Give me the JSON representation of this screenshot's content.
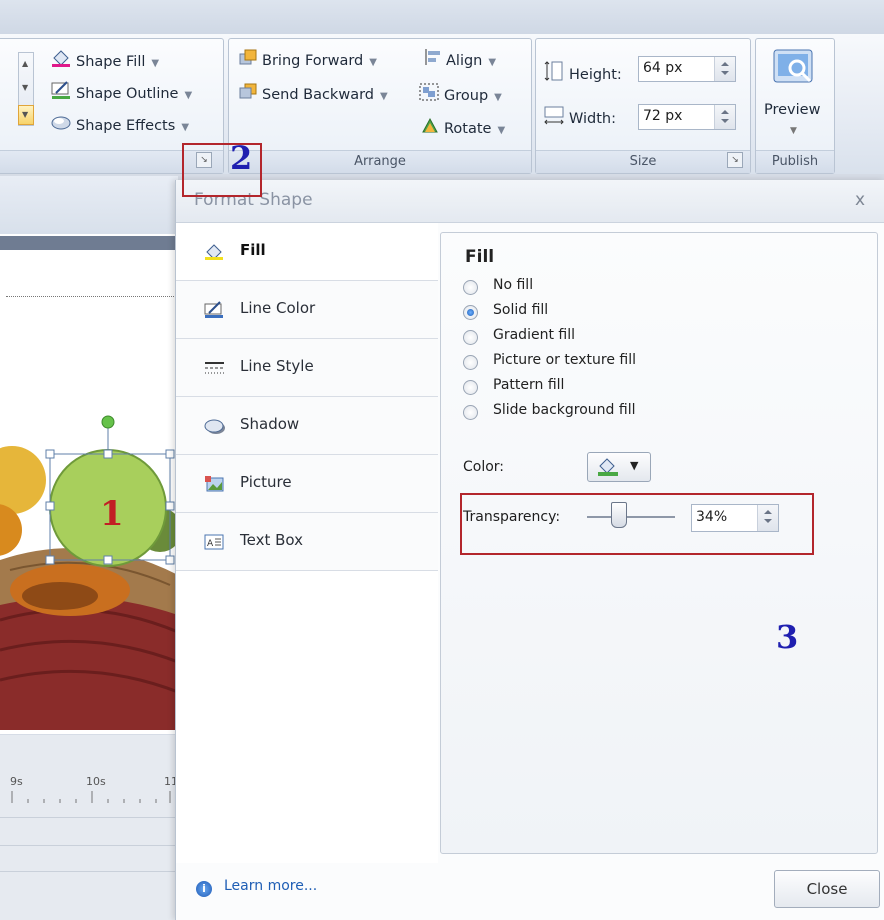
{
  "ribbon": {
    "format_group": {
      "shape_fill": "Shape Fill",
      "shape_outline": "Shape Outline",
      "shape_effects": "Shape Effects"
    },
    "arrange_group": {
      "label": "Arrange",
      "bring_forward": "Bring Forward",
      "send_backward": "Send Backward",
      "align": "Align",
      "group": "Group",
      "rotate": "Rotate"
    },
    "size_group": {
      "label": "Size",
      "height_label": "Height:",
      "height_value": "64 px",
      "width_label": "Width:",
      "width_value": "72 px"
    },
    "publish_group": {
      "label": "Publish",
      "preview": "Preview"
    }
  },
  "dialog": {
    "title": "Format Shape",
    "close_glyph": "x",
    "tabs": [
      {
        "label": "Fill",
        "icon": "paint-bucket-icon",
        "selected": true
      },
      {
        "label": "Line Color",
        "icon": "pen-line-icon",
        "selected": false
      },
      {
        "label": "Line Style",
        "icon": "line-style-icon",
        "selected": false
      },
      {
        "label": "Shadow",
        "icon": "shadow-icon",
        "selected": false
      },
      {
        "label": "Picture",
        "icon": "picture-icon",
        "selected": false
      },
      {
        "label": "Text Box",
        "icon": "textbox-icon",
        "selected": false
      }
    ],
    "fill": {
      "header": "Fill",
      "options": [
        "No fill",
        "Solid fill",
        "Gradient fill",
        "Picture or texture fill",
        "Pattern fill",
        "Slide background fill"
      ],
      "selected_option": "Solid fill",
      "color_label": "Color:",
      "transparency_label": "Transparency:",
      "transparency_value": "34%"
    },
    "learn_more": "Learn more...",
    "close_button": "Close"
  },
  "timeline": {
    "ticks": [
      "9s",
      "10s",
      "11"
    ]
  },
  "annotations": {
    "one": "1",
    "two": "2",
    "three": "3"
  },
  "colors": {
    "annotation_red": "#b3262c",
    "annotation_blue": "#1f1fb0",
    "link_blue": "#1f5eb5"
  }
}
